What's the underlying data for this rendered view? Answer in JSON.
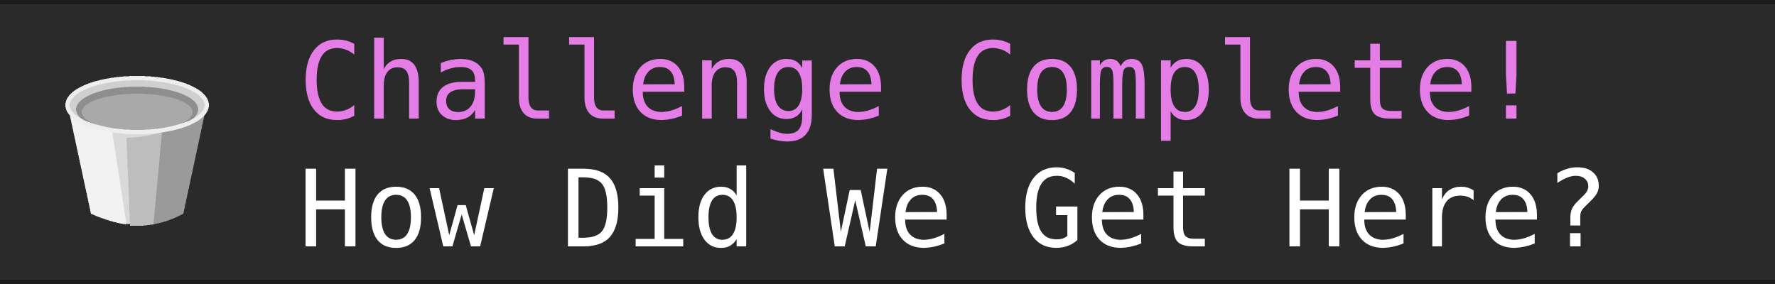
{
  "toast": {
    "title": "Challenge Complete!",
    "subtitle": "How Did We Get Here?",
    "icon": "bucket-icon",
    "colors": {
      "title": "#e57de7",
      "subtitle": "#ffffff",
      "background": "#2a2a2a"
    }
  }
}
